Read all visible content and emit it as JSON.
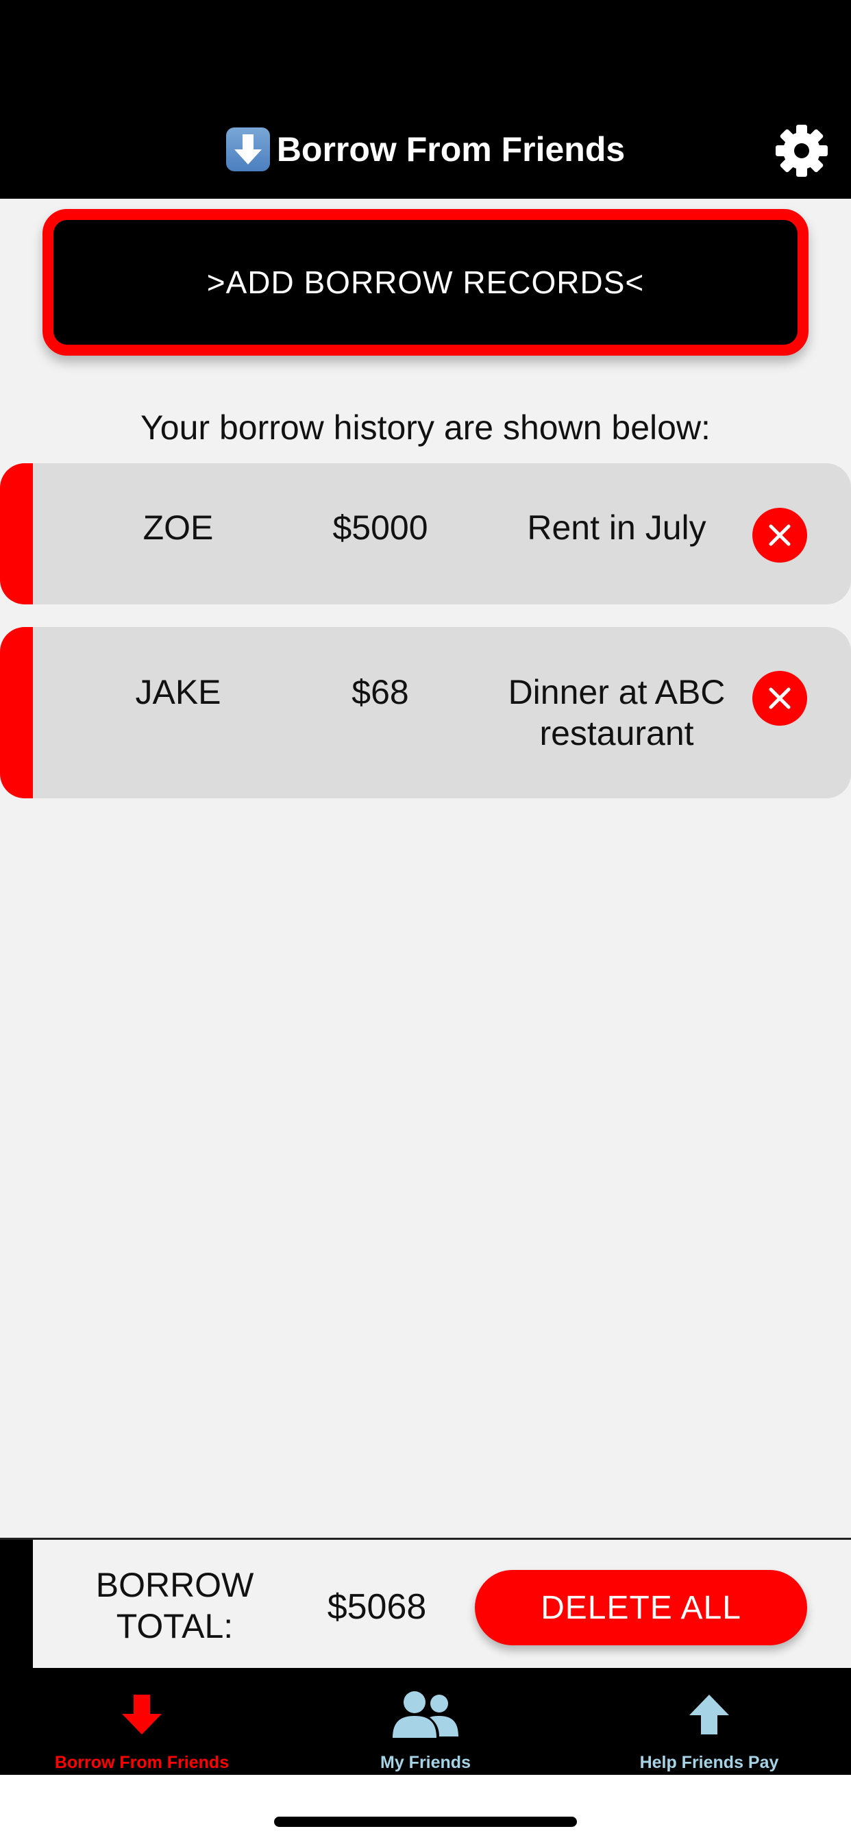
{
  "header": {
    "title": "Borrow From Friends",
    "title_icon": "down-arrow-emoji-icon",
    "settings_icon": "gear-icon"
  },
  "add_button": {
    "label": ">ADD BORROW RECORDS<"
  },
  "history_label": "Your borrow history are shown below:",
  "records": [
    {
      "name": "ZOE",
      "amount": "$5000",
      "note": "Rent in July"
    },
    {
      "name": "JAKE",
      "amount": "$68",
      "note": "Dinner at ABC restaurant"
    }
  ],
  "footer": {
    "total_label": "BORROW TOTAL:",
    "total_value": "$5068",
    "delete_all_label": "DELETE ALL"
  },
  "tabs": [
    {
      "label": "Borrow From Friends",
      "icon": "down-arrow-icon",
      "active": true
    },
    {
      "label": "My Friends",
      "icon": "people-icon",
      "active": false
    },
    {
      "label": "Help Friends Pay",
      "icon": "up-arrow-icon",
      "active": false
    }
  ],
  "colors": {
    "accent": "#ff0000",
    "tab_inactive": "#a7d3e6",
    "record_bg": "#dcdcdc",
    "page_bg": "#f2f2f2"
  }
}
